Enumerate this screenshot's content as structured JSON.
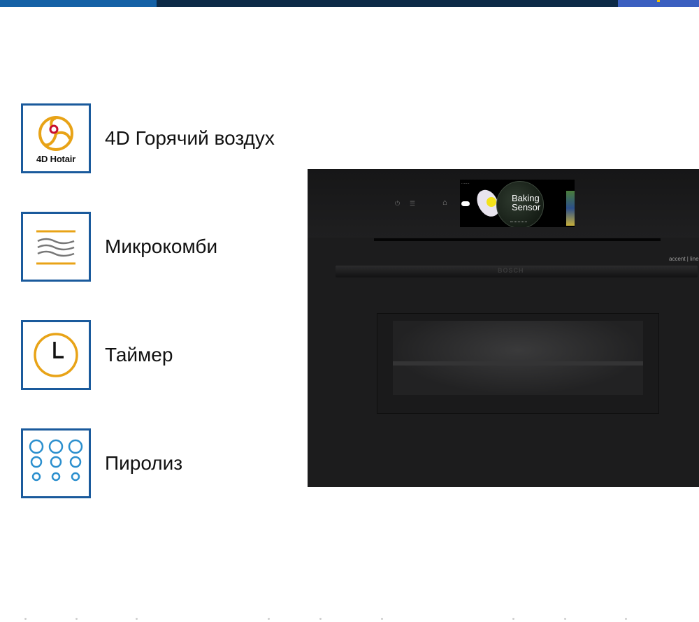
{
  "colors": {
    "topbar_a": "#1561a6",
    "topbar_b": "#0d2a47",
    "topbar_c": "#3b5fc0",
    "icon_border": "#1a5a9c",
    "icon_orange": "#e8a317",
    "icon_red": "#c8102e",
    "icon_blue": "#2b8fce",
    "icon_gray": "#777777"
  },
  "features": [
    {
      "icon": "hotair-fan-icon",
      "caption": "4D Hotair",
      "label": "4D Горячий воздух"
    },
    {
      "icon": "microwave-waves-icon",
      "label": "Микрокомби"
    },
    {
      "icon": "clock-icon",
      "label": "Таймер"
    },
    {
      "icon": "pyrolysis-circles-icon",
      "label": "Пиролиз"
    }
  ],
  "oven": {
    "display_line1": "Baking",
    "display_line2": "Sensor",
    "brand": "BOSCH",
    "series": "accent | line"
  }
}
